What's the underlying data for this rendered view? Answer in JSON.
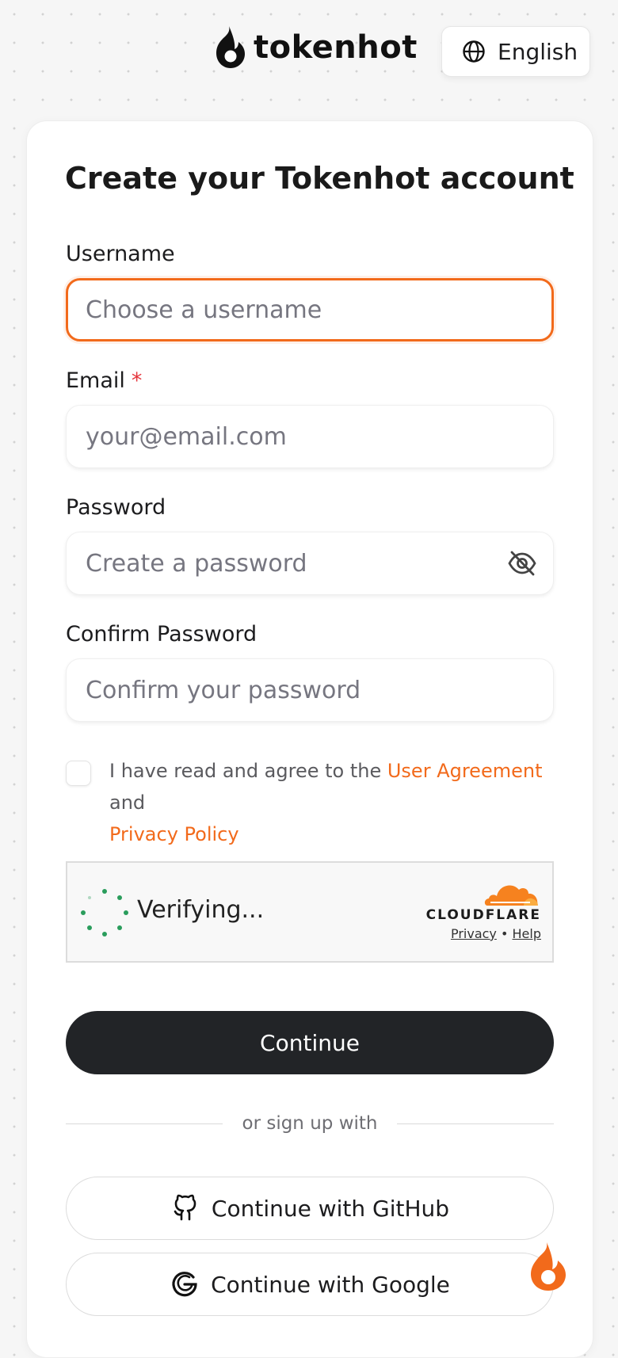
{
  "header": {
    "logo_text": "tokenhot",
    "language_label": "English"
  },
  "form": {
    "title": "Create your Tokenhot account",
    "username": {
      "label": "Username",
      "placeholder": "Choose a username",
      "value": ""
    },
    "email": {
      "label": "Email",
      "required_mark": "*",
      "placeholder": "your@email.com",
      "value": ""
    },
    "password": {
      "label": "Password",
      "placeholder": "Create a password",
      "value": ""
    },
    "confirm_password": {
      "label": "Confirm Password",
      "placeholder": "Confirm your password",
      "value": ""
    },
    "agreement": {
      "prefix": "I have read and agree to the ",
      "user_agreement": "User Agreement",
      "middle": " and",
      "privacy_policy": "Privacy Policy",
      "checked": false
    },
    "captcha": {
      "status": "Verifying...",
      "brand": "CLOUDFLARE",
      "privacy": "Privacy",
      "separator": "•",
      "help": "Help"
    },
    "continue_label": "Continue",
    "divider_text": "or sign up with",
    "github_label": "Continue with GitHub",
    "google_label": "Continue with Google"
  },
  "colors": {
    "accent": "#f26a1b",
    "primary_button": "#222427",
    "required": "#e5363d",
    "spinner": "#2a9d5c"
  },
  "icons": [
    "flame-logo-icon",
    "globe-icon",
    "eye-off-icon",
    "loading-spinner-icon",
    "cloudflare-cloud-icon",
    "github-icon",
    "google-icon",
    "flame-fab-icon"
  ]
}
